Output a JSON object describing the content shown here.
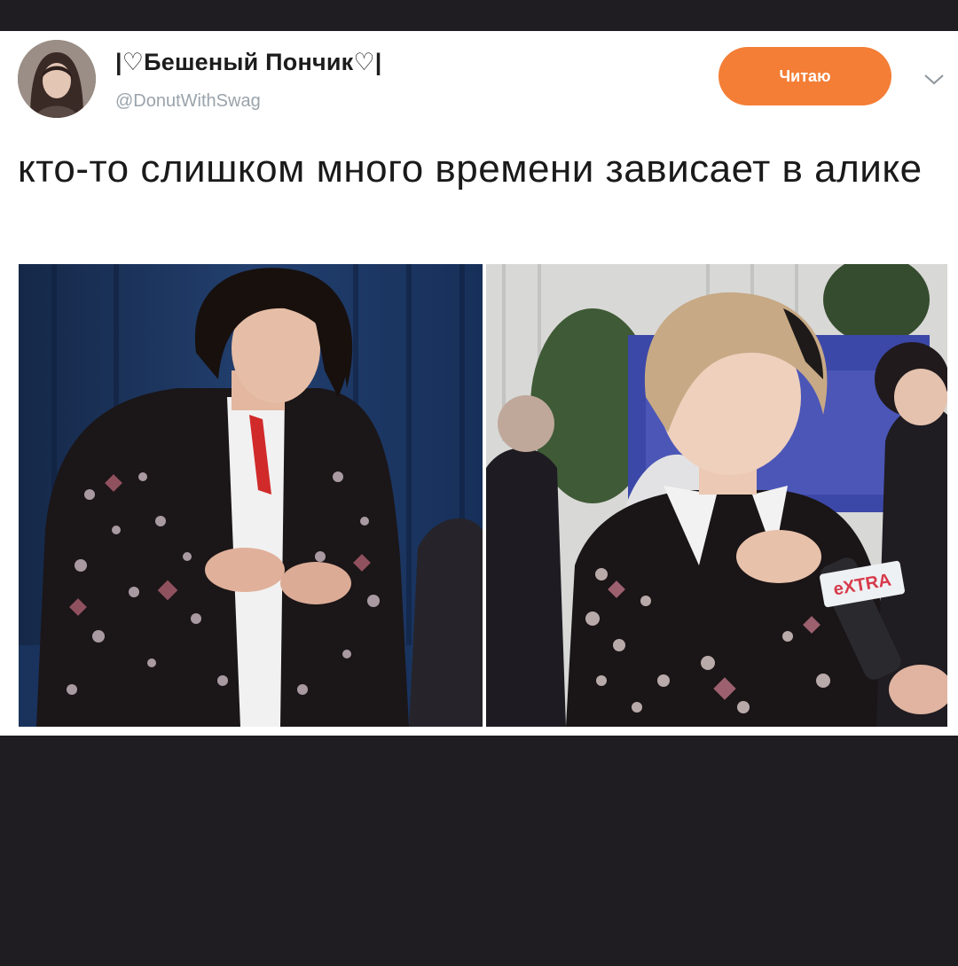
{
  "tweet": {
    "display_name": "|♡Бешеный Пончик♡|",
    "handle": "@DonutWithSwag",
    "follow_label": "Читаю",
    "more_icon": "chevron-down-icon",
    "text": "кто-то слишком много времени зависает в алике"
  },
  "media": {
    "photo_overlay_logo": "eXTRA"
  },
  "colors": {
    "card_bg": "#ffffff",
    "page_bg": "#1f1d22",
    "follow_button": "#f47e36",
    "handle_text": "#9aa3ab"
  }
}
